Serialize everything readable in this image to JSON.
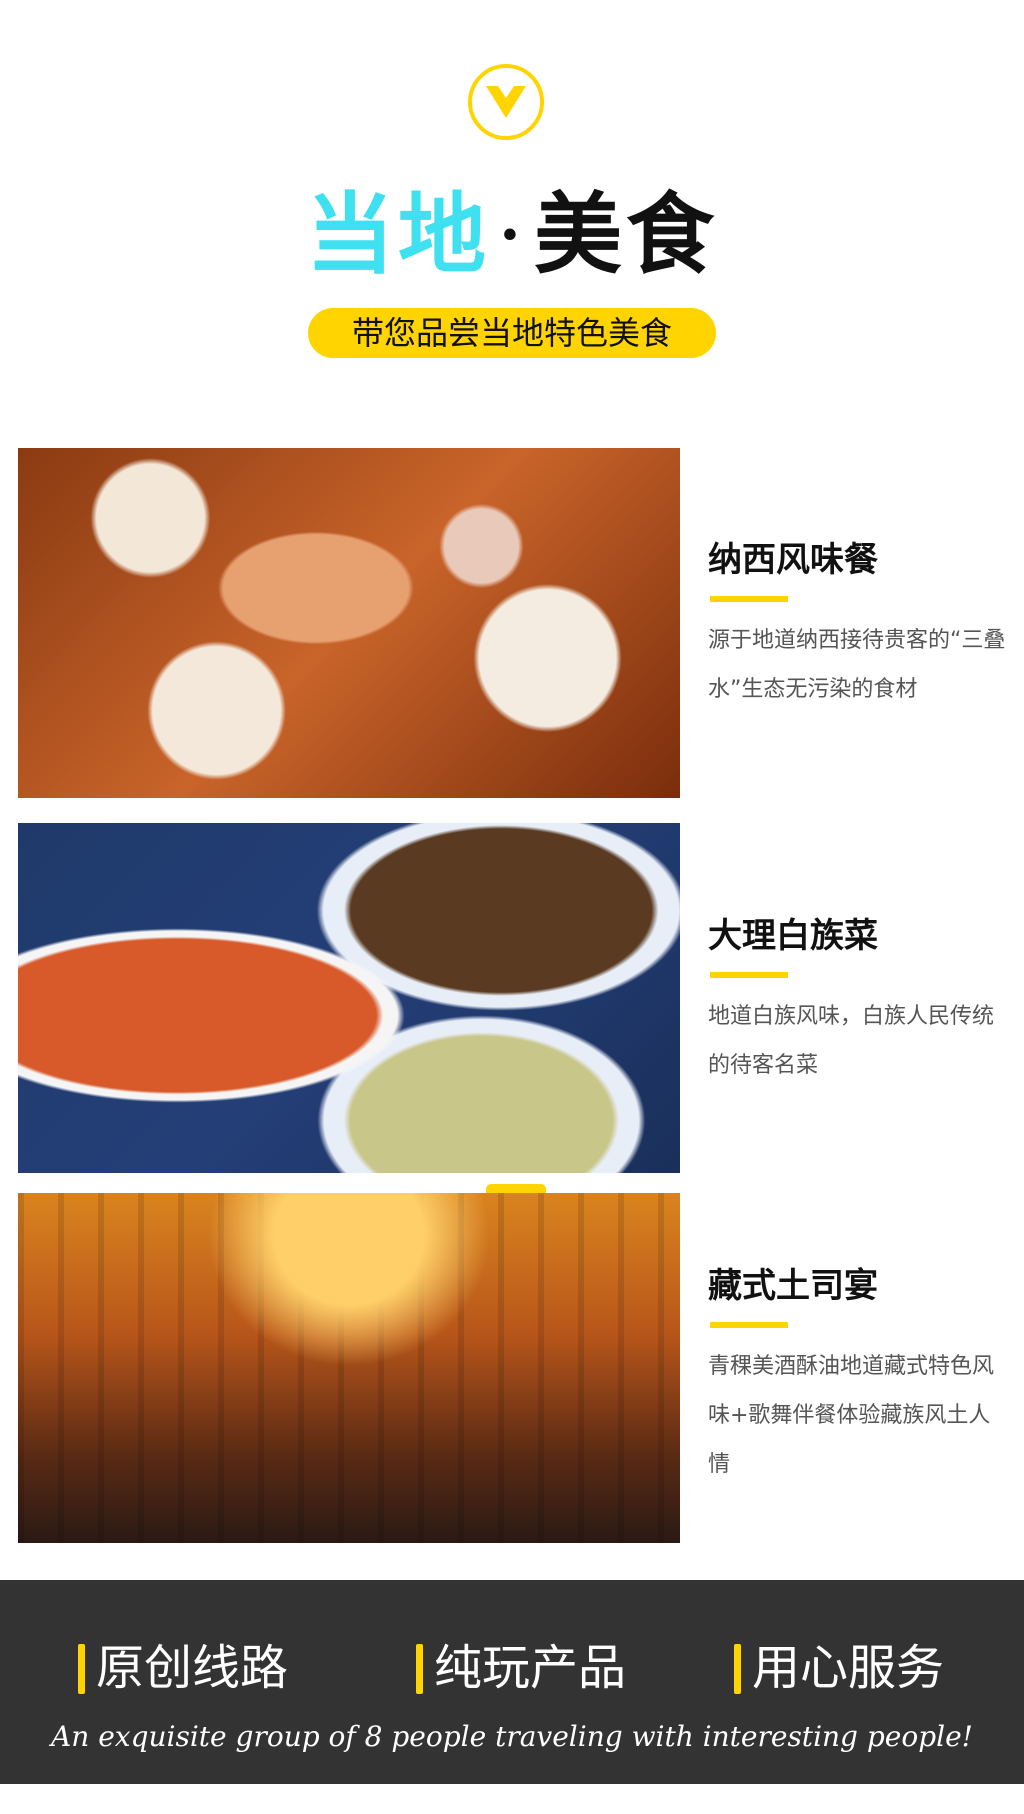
{
  "header": {
    "chevron_icon": "chevron-down-icon",
    "title_part1": "当地",
    "title_separator": "·",
    "title_part2": "美食",
    "subtitle": "带您品尝当地特色美食"
  },
  "items": [
    {
      "title": "纳西风味餐",
      "description": "源于地道纳西接待贵客的“三叠水”生态无污染的食材"
    },
    {
      "title": "大理白族菜",
      "description": "地道白族风味，白族人民传统的待客名菜"
    },
    {
      "title": "藏式土司宴",
      "description": "青稞美酒酥油地道藏式特色风味+歌舞伴餐体验藏族风土人情"
    }
  ],
  "footer": {
    "slogans": [
      "原创线路",
      "纯玩产品",
      "用心服务"
    ],
    "tagline": "An exquisite group of 8 people traveling with interesting people!"
  },
  "colors": {
    "accent_yellow": "#ffd400",
    "title_cyan": "#3fe0f0",
    "footer_bg": "#333333"
  }
}
